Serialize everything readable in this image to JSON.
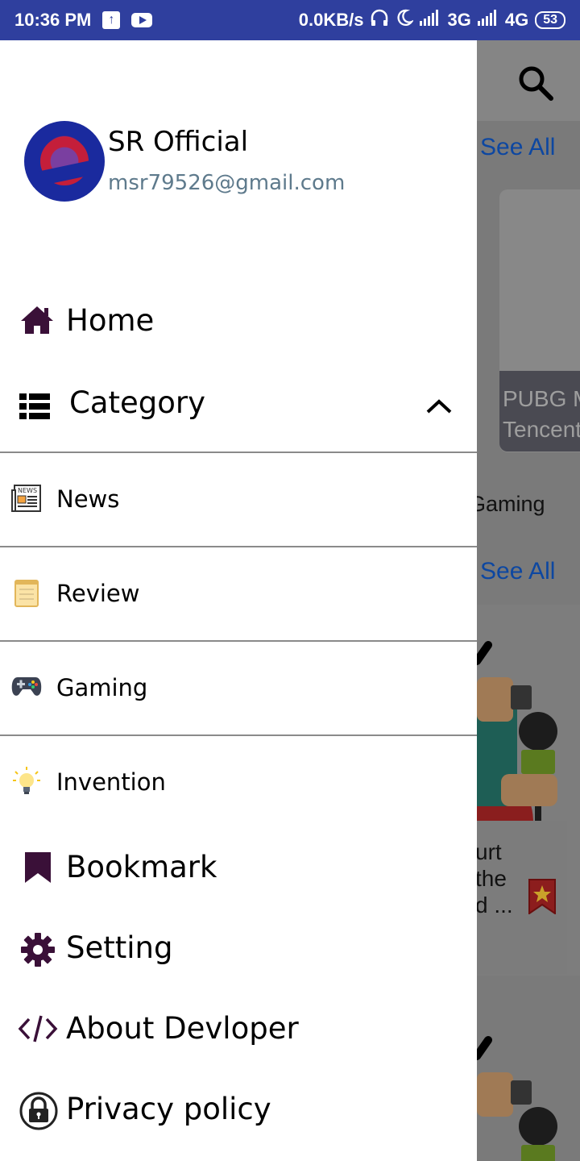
{
  "status_bar": {
    "time": "10:36 PM",
    "net_speed": "0.0KB/s",
    "sim1": "3G",
    "sim2": "4G",
    "battery": "53"
  },
  "profile": {
    "name": "SR Official",
    "email": "msr79526@gmail.com"
  },
  "drawer": {
    "home": "Home",
    "category": "Category",
    "category_items": [
      {
        "label": "News",
        "icon": "newspaper-icon"
      },
      {
        "label": "Review",
        "icon": "notepad-icon"
      },
      {
        "label": "Gaming",
        "icon": "gamepad-icon"
      },
      {
        "label": "Invention",
        "icon": "lightbulb-icon"
      }
    ],
    "bookmark": "Bookmark",
    "setting": "Setting",
    "about": "About Devloper",
    "privacy": "Privacy policy"
  },
  "background": {
    "see_all_1": "See All",
    "see_all_2": "See All",
    "card_title_line1": "PUBG M",
    "card_title_line2": "Tencent",
    "section_label": "Gaming",
    "snippet_line1": "urt",
    "snippet_line2": "the",
    "snippet_line3": "d ..."
  },
  "colors": {
    "status_bar": "#2f3f9e",
    "icon_dark": "#3a1038",
    "email": "#5e7a8c",
    "link": "#0d47a1"
  }
}
